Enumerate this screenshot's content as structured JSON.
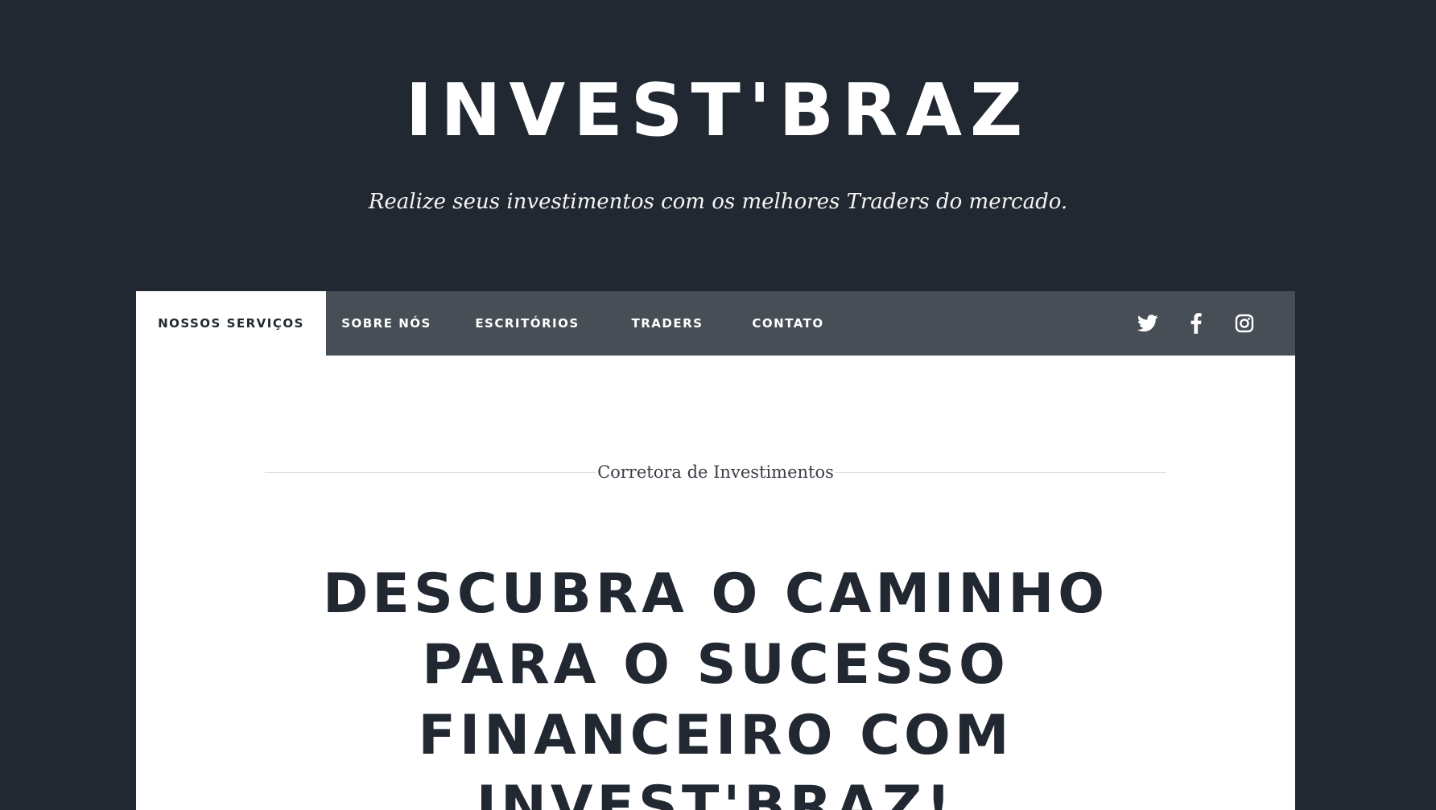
{
  "header": {
    "title": "INVEST'BRAZ",
    "tagline": "Realize seus investimentos com os melhores Traders do mercado."
  },
  "nav": {
    "items": [
      {
        "label": "NOSSOS SERVIÇOS",
        "active": true
      },
      {
        "label": "SOBRE NÓS",
        "active": false
      },
      {
        "label": "ESCRITÓRIOS",
        "active": false
      },
      {
        "label": "TRADERS",
        "active": false
      },
      {
        "label": "CONTATO",
        "active": false
      }
    ],
    "social": [
      {
        "icon": "twitter-icon"
      },
      {
        "icon": "facebook-icon"
      },
      {
        "icon": "instagram-icon"
      }
    ]
  },
  "main": {
    "section_label": "Corretora de Investimentos",
    "heading_lines": [
      "DESCUBRA O CAMINHO",
      "PARA O SUCESSO",
      "FINANCEIRO COM",
      "INVEST'BRAZ!"
    ]
  },
  "colors": {
    "background": "#222831",
    "nav_background": "#484e55",
    "card_background": "#ffffff",
    "heading_text": "#222831"
  }
}
